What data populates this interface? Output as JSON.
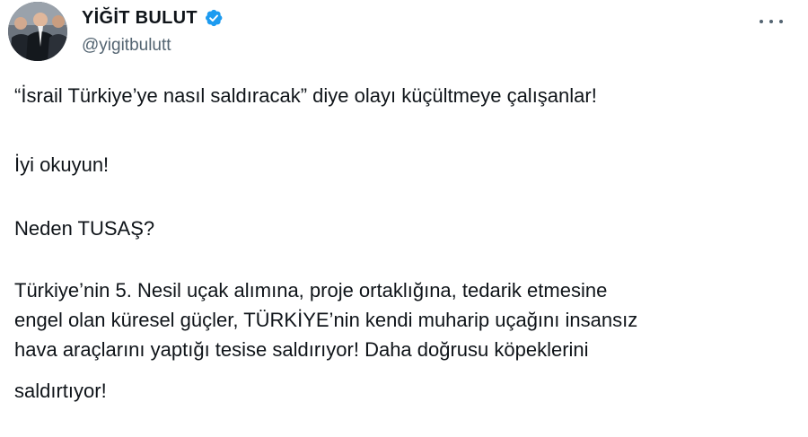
{
  "author": {
    "display_name": "YİĞİT BULUT",
    "handle": "@yigitbulutt",
    "verified": true,
    "verified_color": "#1d9bf0"
  },
  "icons": {
    "verified": "verified-badge-icon",
    "more": "more-options-icon"
  },
  "tweet": {
    "lines": [
      "“İsrail Türkiye’ye nasıl saldıracak” diye olayı küçültmeye çalışanlar!",
      "İyi okuyun!",
      "Neden TUSAŞ?",
      "Türkiye’nin 5. Nesil uçak alımına, proje ortaklığına, tedarik etmesine",
      "engel olan küresel güçler, TÜRKİYE’nin kendi muharip uçağını insansız",
      "hava araçlarını yaptığı tesise saldırıyor! Daha doğrusu köpeklerini",
      "saldırtıyor!"
    ]
  }
}
